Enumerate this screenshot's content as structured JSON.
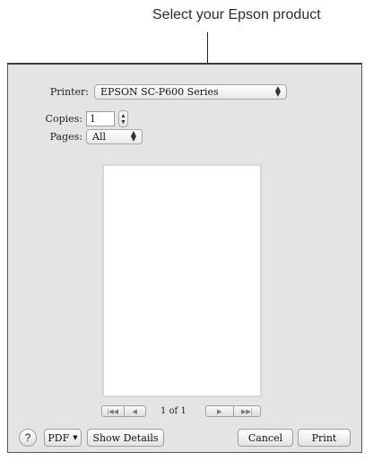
{
  "callout": {
    "text": "Select your Epson product"
  },
  "printer": {
    "label": "Printer:",
    "value": "EPSON SC-P600 Series"
  },
  "copies": {
    "label": "Copies:",
    "value": "1"
  },
  "pages": {
    "label": "Pages:",
    "value": "All"
  },
  "preview": {
    "page_count": "1 of 1"
  },
  "footer": {
    "help_label": "?",
    "pdf_label": "PDF",
    "show_details_label": "Show Details",
    "cancel_label": "Cancel",
    "print_label": "Print"
  },
  "icons": {
    "popup": "up-down-arrows-icon",
    "stepper": "stepper-icon",
    "first": "first-page-icon",
    "prev": "previous-page-icon",
    "next": "next-page-icon",
    "last": "last-page-icon",
    "pdf_menu": "chevron-down-icon"
  }
}
